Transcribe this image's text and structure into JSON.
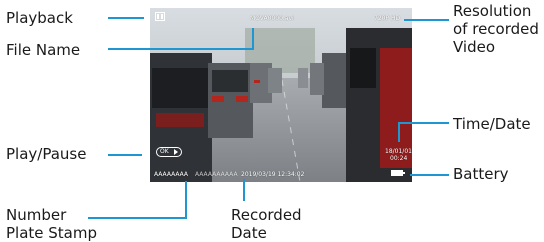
{
  "screen": {
    "file_name": "MOVA0000.avi",
    "resolution": "720P HD",
    "time_date": [
      "18/01/01",
      "00:24"
    ],
    "plate_stamp": "AAAAAAAA",
    "plate_stamp_faded": "AAAAAAAAAA",
    "recorded_date": "2019/03/19  12:34:02",
    "ok_label": "OK"
  },
  "callouts": {
    "playback": "Playback",
    "file_name": "File Name",
    "resolution": [
      "Resolution",
      "of recorded",
      "Video"
    ],
    "time_date": "Time/Date",
    "play_pause": "Play/Pause",
    "battery": "Battery",
    "number_plate_stamp": [
      "Number",
      "Plate Stamp"
    ],
    "recorded_date": [
      "Recorded",
      "Date"
    ]
  },
  "colors": {
    "leader_line": "#1e96d2",
    "label_text": "#1a1a1a",
    "overlay_text": "#ffffff"
  },
  "icons": {
    "playback": "playback-icon",
    "play_pause": "play-pause-icon",
    "battery": "battery-icon"
  }
}
